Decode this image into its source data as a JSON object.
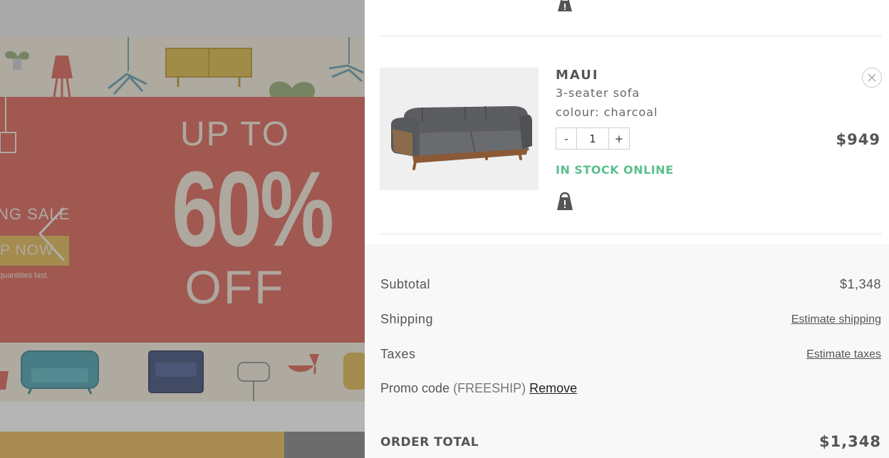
{
  "promo_banner": {
    "up_to": "UP TO",
    "percent": "60%",
    "off": "OFF",
    "sale_partial": "NG SALE",
    "shop_now_partial": "P NOW",
    "fine_print_partial": "quantities last.",
    "colors": {
      "band": "#d9574a",
      "cream": "#f2ecd9",
      "accent": "#e0b244"
    }
  },
  "cart_item": {
    "brand": "MAUI",
    "product": "3-seater sofa",
    "colour": "colour: charcoal",
    "quantity": "1",
    "decrement_label": "-",
    "increment_label": "+",
    "stock_status": "IN STOCK ONLINE",
    "price": "$949",
    "icons": {
      "lock": "lock-icon",
      "remove": "close-icon",
      "image": "sofa-image"
    },
    "colors": {
      "stock": "#5bbf8d"
    }
  },
  "summary": {
    "subtotal_label": "Subtotal",
    "subtotal_value": "$1,348",
    "shipping_label": "Shipping",
    "shipping_link": "Estimate shipping",
    "taxes_label": "Taxes",
    "taxes_link": "Estimate taxes",
    "promo_label": "Promo code",
    "promo_code": "(FREESHIP)",
    "promo_remove": "Remove",
    "total_label": "ORDER TOTAL",
    "total_value": "$1,348"
  }
}
